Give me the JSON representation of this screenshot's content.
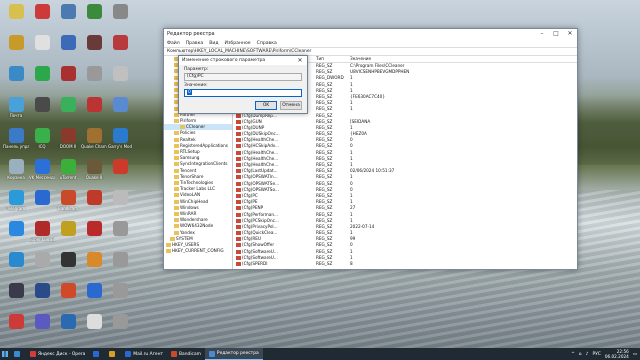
{
  "desktop": {
    "icons": [
      {
        "label": "",
        "color": "#d8c050"
      },
      {
        "label": "",
        "color": "#cc3a3a"
      },
      {
        "label": "",
        "color": "#4a7ab0"
      },
      {
        "label": "",
        "color": "#3c8a3c"
      },
      {
        "label": "",
        "color": "#888"
      },
      {
        "label": "",
        "color": "#c89a2a"
      },
      {
        "label": "",
        "color": "#e0e0e0"
      },
      {
        "label": "",
        "color": "#3a6ab8"
      },
      {
        "label": "",
        "color": "#6a3a3a"
      },
      {
        "label": "",
        "color": "#b83a3a"
      },
      {
        "label": "",
        "color": "#3a8ac8"
      },
      {
        "label": "",
        "color": "#2aa84a"
      },
      {
        "label": "",
        "color": "#a83030"
      },
      {
        "label": "",
        "color": "#999"
      },
      {
        "label": "",
        "color": "#c0c0c0"
      },
      {
        "label": "Почта",
        "color": "#4aa0d8"
      },
      {
        "label": "",
        "color": "#4a4a4a"
      },
      {
        "label": "",
        "color": "#3ab05a"
      },
      {
        "label": "",
        "color": "#bb3333"
      },
      {
        "label": "",
        "color": "#5a8ad0"
      },
      {
        "label": "Панель управления",
        "color": "#3a7ac8"
      },
      {
        "label": "ICQ",
        "color": "#3ab04a"
      },
      {
        "label": "DOOM II",
        "color": "#8a3a2a"
      },
      {
        "label": "Quake Champions",
        "color": "#a07030"
      },
      {
        "label": "Garry's Mod",
        "color": "#2a7ad0"
      },
      {
        "label": "Корзина",
        "color": "#9ab0c0"
      },
      {
        "label": "VK Мессенджер",
        "color": "#2a70d8"
      },
      {
        "label": "uTorrent",
        "color": "#3ab03a"
      },
      {
        "label": "Quake II",
        "color": "#6a5a3a"
      },
      {
        "label": "",
        "color": "#cc3a2a"
      },
      {
        "label": "Telegram",
        "color": "#2a9ad8"
      },
      {
        "label": "",
        "color": "#2a6ad0"
      },
      {
        "label": "Bandicam",
        "color": "#c84a2a"
      },
      {
        "label": "",
        "color": "#c03a2a"
      },
      {
        "label": "",
        "color": "#bbb"
      },
      {
        "label": "",
        "color": "#2a88e0"
      },
      {
        "label": "Super Lux Edition",
        "color": "#b02a2a"
      },
      {
        "label": "",
        "color": "#c0a020"
      },
      {
        "label": "",
        "color": "#bb2a2a"
      },
      {
        "label": "",
        "color": "#999"
      },
      {
        "label": "",
        "color": "#2a8ad0"
      },
      {
        "label": "",
        "color": "#aaa"
      },
      {
        "label": "",
        "color": "#333"
      },
      {
        "label": "",
        "color": "#d88a2a"
      },
      {
        "label": "",
        "color": "#999"
      },
      {
        "label": "",
        "color": "#3a3a4a"
      },
      {
        "label": "",
        "color": "#2a4a8a"
      },
      {
        "label": "",
        "color": "#d04a2a"
      },
      {
        "label": "",
        "color": "#2a6ad0"
      },
      {
        "label": "",
        "color": "#999"
      },
      {
        "label": "",
        "color": "#cc3a3a"
      },
      {
        "label": "",
        "color": "#5a5ac0"
      },
      {
        "label": "",
        "color": "#2a6ab0"
      },
      {
        "label": "",
        "color": "#ddd"
      },
      {
        "label": "",
        "color": "#999"
      }
    ]
  },
  "regedit": {
    "title": "Редактор реестра",
    "menu": [
      "Файл",
      "Правка",
      "Вид",
      "Избранное",
      "Справка"
    ],
    "address": "Компьютер\\HKEY_LOCAL_MACHINE\\SOFTWARE\\Piriform\\CCleaner",
    "tree": [
      "Mozilla",
      "MozillaPlugins",
      "Netflix",
      "Nuance",
      "NVIDIA Corporation",
      "ODBC",
      "OEM",
      "OpenSSH",
      "Oracle",
      "Partner",
      "Piriform",
      "CCleaner",
      "Policies",
      "Realtek",
      "RegisteredApplications",
      "RTLSetup",
      "Samsung",
      "SyncIntegrationClients",
      "Tencent",
      "TenorShare",
      "TinTechnologies",
      "Tracker Labs LLC",
      "VideoLAN",
      "WinChipHead",
      "Windows",
      "WinRAR",
      "Wondershare",
      "WOW6432Node",
      "Yandex",
      "SYSTEM",
      "HKEY_USERS",
      "HKEY_CURRENT_CONFIG"
    ],
    "columns": {
      "name": "Имя",
      "type": "Тип",
      "value": "Значение"
    },
    "rows": [
      {
        "name": "(По умолчанию)",
        "type": "REG_SZ",
        "value": "C:\\Program Files\\CCleaner",
        "kind": "sz"
      },
      {
        "name": "(Cfg)BrandingID",
        "type": "REG_SZ",
        "value": "U8VICSENHPBEVGMDPPHEN",
        "kind": "sz"
      },
      {
        "name": "(Cfg)CheckTrial",
        "type": "REG_DWORD",
        "value": "1",
        "kind": "dw"
      },
      {
        "name": "(Cfg)CustomIndex",
        "type": "REG_SZ",
        "value": "1",
        "kind": "sz"
      },
      {
        "name": "(Cfg)DefaultProfile",
        "type": "REG_SZ",
        "value": "1",
        "kind": "sz"
      },
      {
        "name": "(Cfg)DUI",
        "type": "REG_SZ",
        "value": "{FE630AC7C40}",
        "kind": "sz"
      },
      {
        "name": "(Cfg)DumpUp",
        "type": "REG_SZ",
        "value": "1",
        "kind": "sz"
      },
      {
        "name": "(Cfg)GTHP",
        "type": "REG_SZ",
        "value": "1",
        "kind": "sz"
      },
      {
        "name": "(Cfg)DumpRep...",
        "type": "REG_SZ",
        "value": "",
        "kind": "sz"
      },
      {
        "name": "(Cfg)GUN",
        "type": "REG_SZ",
        "value": "[SEIDANA",
        "kind": "sz"
      },
      {
        "name": "(Cfg)DUNP",
        "type": "REG_SZ",
        "value": "1",
        "kind": "sz"
      },
      {
        "name": "(Cfg)DUSkipOnc...",
        "type": "REG_SZ",
        "value": "{HEZ0A",
        "kind": "sz"
      },
      {
        "name": "(Cfg)HealthChe...",
        "type": "REG_SZ",
        "value": "0",
        "kind": "sz"
      },
      {
        "name": "(Cfg)HCSkipAdv...",
        "type": "REG_SZ",
        "value": "0",
        "kind": "sz"
      },
      {
        "name": "(Cfg)HealthChe...",
        "type": "REG_SZ",
        "value": "1",
        "kind": "sz"
      },
      {
        "name": "(Cfg)HealthChe...",
        "type": "REG_SZ",
        "value": "1",
        "kind": "sz"
      },
      {
        "name": "(Cfg)HealthChe...",
        "type": "REG_SZ",
        "value": "1",
        "kind": "sz"
      },
      {
        "name": "(Cfg)LastUpdat...",
        "type": "REG_SZ",
        "value": "02/06/2024 10:51:37",
        "kind": "sz"
      },
      {
        "name": "(Cfg)OPSWATIn...",
        "type": "REG_SZ",
        "value": "1",
        "kind": "sz"
      },
      {
        "name": "(Cfg)OPSWATSe...",
        "type": "REG_SZ",
        "value": "0",
        "kind": "sz"
      },
      {
        "name": "(Cfg)OPSWATSo...",
        "type": "REG_SZ",
        "value": "0",
        "kind": "sz"
      },
      {
        "name": "(Cfg)PC",
        "type": "REG_SZ",
        "value": "1",
        "kind": "sz"
      },
      {
        "name": "(Cfg)PE",
        "type": "REG_SZ",
        "value": "1",
        "kind": "sz"
      },
      {
        "name": "(Cfg)PENP",
        "type": "REG_SZ",
        "value": "27",
        "kind": "sz"
      },
      {
        "name": "(Cfg)Performan...",
        "type": "REG_SZ",
        "value": "1",
        "kind": "sz"
      },
      {
        "name": "(Cfg)PCSkipOnc...",
        "type": "REG_SZ",
        "value": "1",
        "kind": "sz"
      },
      {
        "name": "(Cfg)PrivacyPol...",
        "type": "REG_SZ",
        "value": "2022-07-14",
        "kind": "sz"
      },
      {
        "name": "(Cfg)QuickClea...",
        "type": "REG_SZ",
        "value": "1",
        "kind": "sz"
      },
      {
        "name": "(Cfg)REU",
        "type": "REG_SZ",
        "value": "99",
        "kind": "sz"
      },
      {
        "name": "(Cfg)ShowOffer",
        "type": "REG_SZ",
        "value": "0",
        "kind": "sz"
      },
      {
        "name": "(Cfg)SoftwareU...",
        "type": "REG_SZ",
        "value": "1",
        "kind": "sz"
      },
      {
        "name": "(Cfg)SoftwareU...",
        "type": "REG_SZ",
        "value": "1",
        "kind": "sz"
      },
      {
        "name": "(Cfg)SPERDI",
        "type": "REG_SZ",
        "value": "8",
        "kind": "sz"
      }
    ]
  },
  "dialog": {
    "title": "Изменение строкового параметра",
    "param_label": "Параметр:",
    "param_value": "(Cfg)PC",
    "value_label": "Значение:",
    "value_value": "0",
    "ok_label": "OK",
    "cancel_label": "Отмена",
    "close_glyph": "✕"
  },
  "taskbar": {
    "items": [
      {
        "label": "",
        "color": "#3a8ad8"
      },
      {
        "label": "Яндекс Диск - Opera",
        "color": "#d83a3a"
      },
      {
        "label": "",
        "color": "#2a6ad0"
      },
      {
        "label": "",
        "color": "#d8a020"
      },
      {
        "label": "Mail.ru Агент",
        "color": "#2a6ad0"
      },
      {
        "label": "Bandicam",
        "color": "#c84a2a"
      },
      {
        "label": "Редактор реестра",
        "color": "#4a8ad0"
      }
    ],
    "tray_lang": "РУС",
    "time": "22:56",
    "date": "06.02.2024"
  }
}
